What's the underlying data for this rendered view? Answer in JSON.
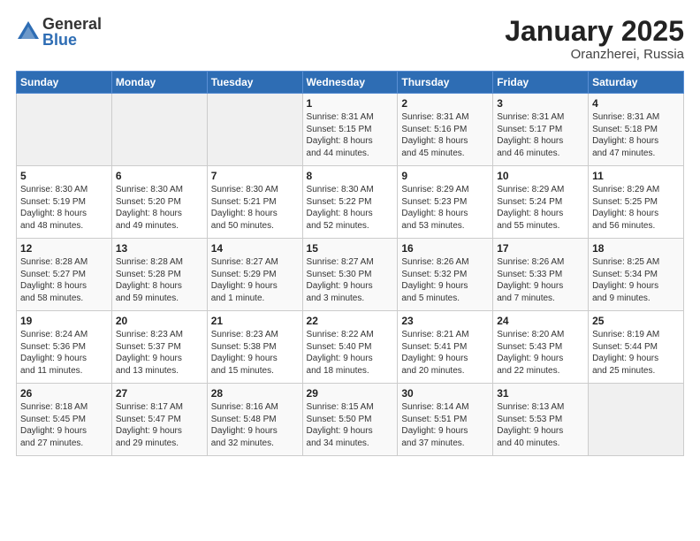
{
  "logo": {
    "general": "General",
    "blue": "Blue"
  },
  "header": {
    "month": "January 2025",
    "location": "Oranzherei, Russia"
  },
  "weekdays": [
    "Sunday",
    "Monday",
    "Tuesday",
    "Wednesday",
    "Thursday",
    "Friday",
    "Saturday"
  ],
  "weeks": [
    [
      {
        "day": "",
        "info": ""
      },
      {
        "day": "",
        "info": ""
      },
      {
        "day": "",
        "info": ""
      },
      {
        "day": "1",
        "info": "Sunrise: 8:31 AM\nSunset: 5:15 PM\nDaylight: 8 hours\nand 44 minutes."
      },
      {
        "day": "2",
        "info": "Sunrise: 8:31 AM\nSunset: 5:16 PM\nDaylight: 8 hours\nand 45 minutes."
      },
      {
        "day": "3",
        "info": "Sunrise: 8:31 AM\nSunset: 5:17 PM\nDaylight: 8 hours\nand 46 minutes."
      },
      {
        "day": "4",
        "info": "Sunrise: 8:31 AM\nSunset: 5:18 PM\nDaylight: 8 hours\nand 47 minutes."
      }
    ],
    [
      {
        "day": "5",
        "info": "Sunrise: 8:30 AM\nSunset: 5:19 PM\nDaylight: 8 hours\nand 48 minutes."
      },
      {
        "day": "6",
        "info": "Sunrise: 8:30 AM\nSunset: 5:20 PM\nDaylight: 8 hours\nand 49 minutes."
      },
      {
        "day": "7",
        "info": "Sunrise: 8:30 AM\nSunset: 5:21 PM\nDaylight: 8 hours\nand 50 minutes."
      },
      {
        "day": "8",
        "info": "Sunrise: 8:30 AM\nSunset: 5:22 PM\nDaylight: 8 hours\nand 52 minutes."
      },
      {
        "day": "9",
        "info": "Sunrise: 8:29 AM\nSunset: 5:23 PM\nDaylight: 8 hours\nand 53 minutes."
      },
      {
        "day": "10",
        "info": "Sunrise: 8:29 AM\nSunset: 5:24 PM\nDaylight: 8 hours\nand 55 minutes."
      },
      {
        "day": "11",
        "info": "Sunrise: 8:29 AM\nSunset: 5:25 PM\nDaylight: 8 hours\nand 56 minutes."
      }
    ],
    [
      {
        "day": "12",
        "info": "Sunrise: 8:28 AM\nSunset: 5:27 PM\nDaylight: 8 hours\nand 58 minutes."
      },
      {
        "day": "13",
        "info": "Sunrise: 8:28 AM\nSunset: 5:28 PM\nDaylight: 8 hours\nand 59 minutes."
      },
      {
        "day": "14",
        "info": "Sunrise: 8:27 AM\nSunset: 5:29 PM\nDaylight: 9 hours\nand 1 minute."
      },
      {
        "day": "15",
        "info": "Sunrise: 8:27 AM\nSunset: 5:30 PM\nDaylight: 9 hours\nand 3 minutes."
      },
      {
        "day": "16",
        "info": "Sunrise: 8:26 AM\nSunset: 5:32 PM\nDaylight: 9 hours\nand 5 minutes."
      },
      {
        "day": "17",
        "info": "Sunrise: 8:26 AM\nSunset: 5:33 PM\nDaylight: 9 hours\nand 7 minutes."
      },
      {
        "day": "18",
        "info": "Sunrise: 8:25 AM\nSunset: 5:34 PM\nDaylight: 9 hours\nand 9 minutes."
      }
    ],
    [
      {
        "day": "19",
        "info": "Sunrise: 8:24 AM\nSunset: 5:36 PM\nDaylight: 9 hours\nand 11 minutes."
      },
      {
        "day": "20",
        "info": "Sunrise: 8:23 AM\nSunset: 5:37 PM\nDaylight: 9 hours\nand 13 minutes."
      },
      {
        "day": "21",
        "info": "Sunrise: 8:23 AM\nSunset: 5:38 PM\nDaylight: 9 hours\nand 15 minutes."
      },
      {
        "day": "22",
        "info": "Sunrise: 8:22 AM\nSunset: 5:40 PM\nDaylight: 9 hours\nand 18 minutes."
      },
      {
        "day": "23",
        "info": "Sunrise: 8:21 AM\nSunset: 5:41 PM\nDaylight: 9 hours\nand 20 minutes."
      },
      {
        "day": "24",
        "info": "Sunrise: 8:20 AM\nSunset: 5:43 PM\nDaylight: 9 hours\nand 22 minutes."
      },
      {
        "day": "25",
        "info": "Sunrise: 8:19 AM\nSunset: 5:44 PM\nDaylight: 9 hours\nand 25 minutes."
      }
    ],
    [
      {
        "day": "26",
        "info": "Sunrise: 8:18 AM\nSunset: 5:45 PM\nDaylight: 9 hours\nand 27 minutes."
      },
      {
        "day": "27",
        "info": "Sunrise: 8:17 AM\nSunset: 5:47 PM\nDaylight: 9 hours\nand 29 minutes."
      },
      {
        "day": "28",
        "info": "Sunrise: 8:16 AM\nSunset: 5:48 PM\nDaylight: 9 hours\nand 32 minutes."
      },
      {
        "day": "29",
        "info": "Sunrise: 8:15 AM\nSunset: 5:50 PM\nDaylight: 9 hours\nand 34 minutes."
      },
      {
        "day": "30",
        "info": "Sunrise: 8:14 AM\nSunset: 5:51 PM\nDaylight: 9 hours\nand 37 minutes."
      },
      {
        "day": "31",
        "info": "Sunrise: 8:13 AM\nSunset: 5:53 PM\nDaylight: 9 hours\nand 40 minutes."
      },
      {
        "day": "",
        "info": ""
      }
    ]
  ]
}
